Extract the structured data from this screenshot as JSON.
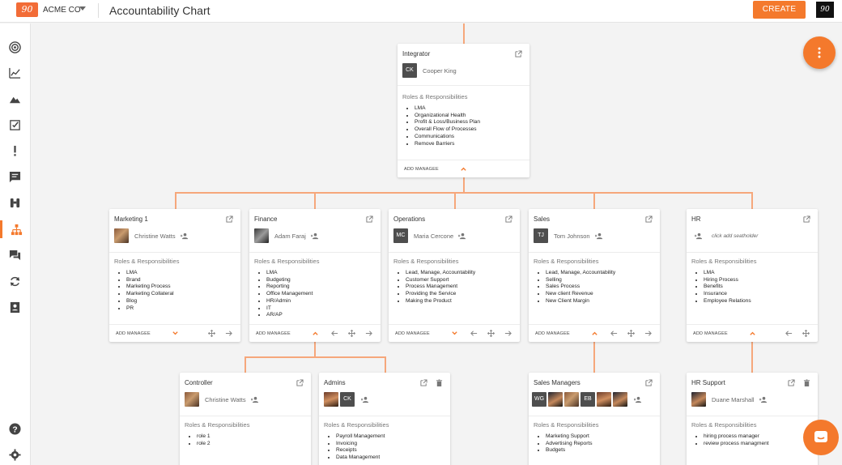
{
  "header": {
    "logo_text": "90",
    "company": "ACME CO",
    "title": "Accountability Chart",
    "create_label": "CREATE",
    "user_logo_text": "90"
  },
  "colors": {
    "accent": "#f4792c",
    "connector": "#f6a77b",
    "background": "#f3f3f3"
  },
  "sidebar": {
    "items": [
      {
        "icon": "target-icon"
      },
      {
        "icon": "line-chart-icon"
      },
      {
        "icon": "mountain-icon"
      },
      {
        "icon": "checkbox-icon"
      },
      {
        "icon": "exclamation-icon"
      },
      {
        "icon": "list-feedback-icon"
      },
      {
        "icon": "binoculars-icon"
      },
      {
        "icon": "org-chart-icon",
        "active": true
      },
      {
        "icon": "chat-icon"
      },
      {
        "icon": "sync-icon"
      },
      {
        "icon": "contact-card-icon"
      },
      {
        "icon": "help-icon"
      },
      {
        "icon": "settings-icon"
      }
    ]
  },
  "roles_heading": "Roles & Responsibilities",
  "add_managee_label": "ADD MANAGEE",
  "cards": {
    "integrator": {
      "title": "Integrator",
      "person": {
        "initials": "CK",
        "name": "Cooper King"
      },
      "roles": [
        "LMA",
        "Organizational Health",
        "Profit & Loss/Business Plan",
        "Overall Flow of Processes",
        "Communications",
        "Remove Barriers"
      ]
    },
    "marketing": {
      "title": "Marketing 1",
      "person": {
        "name": "Christine Watts"
      },
      "roles": [
        "LMA",
        "Brand",
        "Marketing Process",
        "Marketing Collateral",
        "Blog",
        "PR"
      ]
    },
    "finance": {
      "title": "Finance",
      "person": {
        "name": "Adam Faraj"
      },
      "roles": [
        "LMA",
        "Budgeting",
        "Reporting",
        "Office Management",
        "HR/Admin",
        "IT",
        "AR/AP"
      ]
    },
    "operations": {
      "title": "Operations",
      "person": {
        "initials": "MC",
        "name": "Maria Cercone"
      },
      "roles": [
        "Lead, Manage, Accountability",
        "Customer Support",
        "Process Management",
        "Providing the Service",
        "Making the Product"
      ]
    },
    "sales": {
      "title": "Sales",
      "person": {
        "initials": "TJ",
        "name": "Tom Johnson"
      },
      "roles": [
        "Lead, Manage, Accountability",
        "Selling",
        "Sales Process",
        "New client Revenue",
        "New Client Margin"
      ]
    },
    "hr": {
      "title": "HR",
      "placeholder": "click add seatholder",
      "roles": [
        "LMA",
        "Hiring Process",
        "Benefits",
        "Insurance",
        "Employee Relations"
      ]
    },
    "controller": {
      "title": "Controller",
      "person": {
        "name": "Christine Watts"
      },
      "roles": [
        "role 1",
        "role 2"
      ]
    },
    "admins": {
      "title": "Admins",
      "people": [
        {
          "initials": ""
        },
        {
          "initials": "CK"
        }
      ],
      "roles": [
        "Payroll Management",
        "Invoicing",
        "Receipts",
        "Data Management"
      ]
    },
    "sales_managers": {
      "title": "Sales Managers",
      "people": [
        {
          "initials": "WG"
        },
        {
          "initials": ""
        },
        {
          "initials": ""
        },
        {
          "initials": "EB"
        },
        {
          "initials": ""
        },
        {
          "initials": ""
        }
      ],
      "roles": [
        "Marketing Support",
        "Advertising Reports",
        "Budgets"
      ]
    },
    "hr_support": {
      "title": "HR Support",
      "person": {
        "name": "Duane Marshall"
      },
      "roles": [
        "hiring process manager",
        "review process managment"
      ]
    }
  }
}
